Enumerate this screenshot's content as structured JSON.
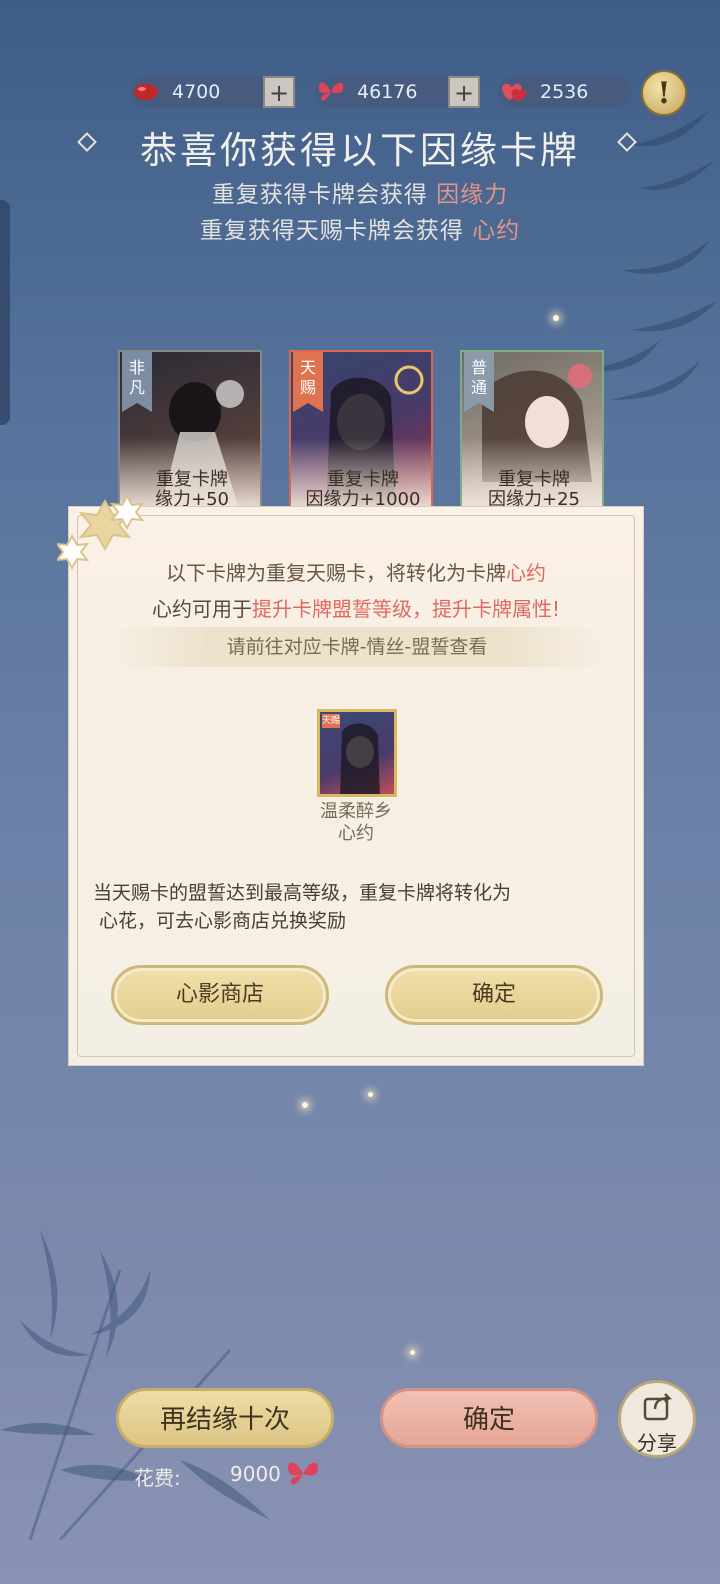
{
  "currency": [
    {
      "icon": "red-bean-icon",
      "value": "4700",
      "has_plus": true
    },
    {
      "icon": "red-butterfly-icon",
      "value": "46176",
      "has_plus": true
    },
    {
      "icon": "hearts-icon",
      "value": "2536",
      "has_plus": false
    }
  ],
  "info_button": "!",
  "title": "恭喜你获得以下因缘卡牌",
  "subtitle1": {
    "prefix": "重复获得卡牌会获得",
    "highlight": "因缘力"
  },
  "subtitle2": {
    "prefix": "重复获得天赐卡牌会获得",
    "highlight": "心约"
  },
  "cards": [
    {
      "rarity": "非凡",
      "line1": "重复卡牌",
      "line2": "缘力+50"
    },
    {
      "rarity": "天赐",
      "line1": "重复卡牌",
      "line2": "因缘力+1000"
    },
    {
      "rarity": "普通",
      "line1": "重复卡牌",
      "line2": "因缘力+25"
    }
  ],
  "dialog": {
    "line1_prefix": "以下卡牌为重复天赐卡，将转化为卡牌",
    "line1_highlight": "心约",
    "line2_prefix": "心约可用于",
    "line2_highlight": "提升卡牌盟誓等级，提升卡牌属性!",
    "banner": "请前往对应卡牌-情丝-盟誓查看",
    "mini_card_rarity": "天赐",
    "mini_card_name": "温柔醉乡",
    "mini_card_type": "心约",
    "footer_line1": "当天赐卡的盟誓达到最高等级，重复卡牌将转化为",
    "footer_line2": "心花，可去心影商店兑换奖励",
    "shop_button": "心影商店",
    "confirm_button": "确定"
  },
  "bottom": {
    "again_button": "再结缘十次",
    "confirm_button": "确定",
    "share_button": "分享",
    "cost_label": "花费:",
    "cost_value": "9000"
  },
  "colors": {
    "accent_red": "#e06a5f",
    "gold": "#e2cd8b",
    "background": "#56729b"
  }
}
